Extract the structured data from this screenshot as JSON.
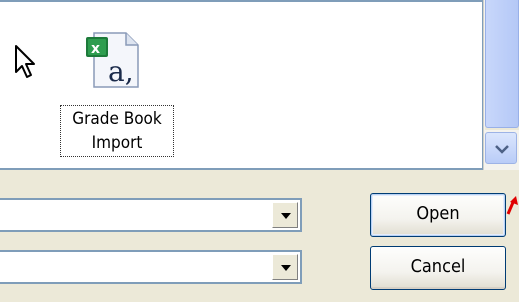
{
  "file_list": {
    "items": [
      {
        "label_line1": "Grade Book",
        "label_line2": "Import",
        "icon": "excel-csv-file-icon"
      }
    ]
  },
  "filename_combo": {
    "value": ""
  },
  "filetype_combo": {
    "value": ""
  },
  "buttons": {
    "open_label": "Open",
    "cancel_label": "Cancel"
  },
  "colors": {
    "dialog_bg": "#ece9d8",
    "border": "#7f9db9",
    "button_border": "#003c74",
    "annotation_arrow": "#e00000",
    "excel_green": "#1d7a3a"
  }
}
